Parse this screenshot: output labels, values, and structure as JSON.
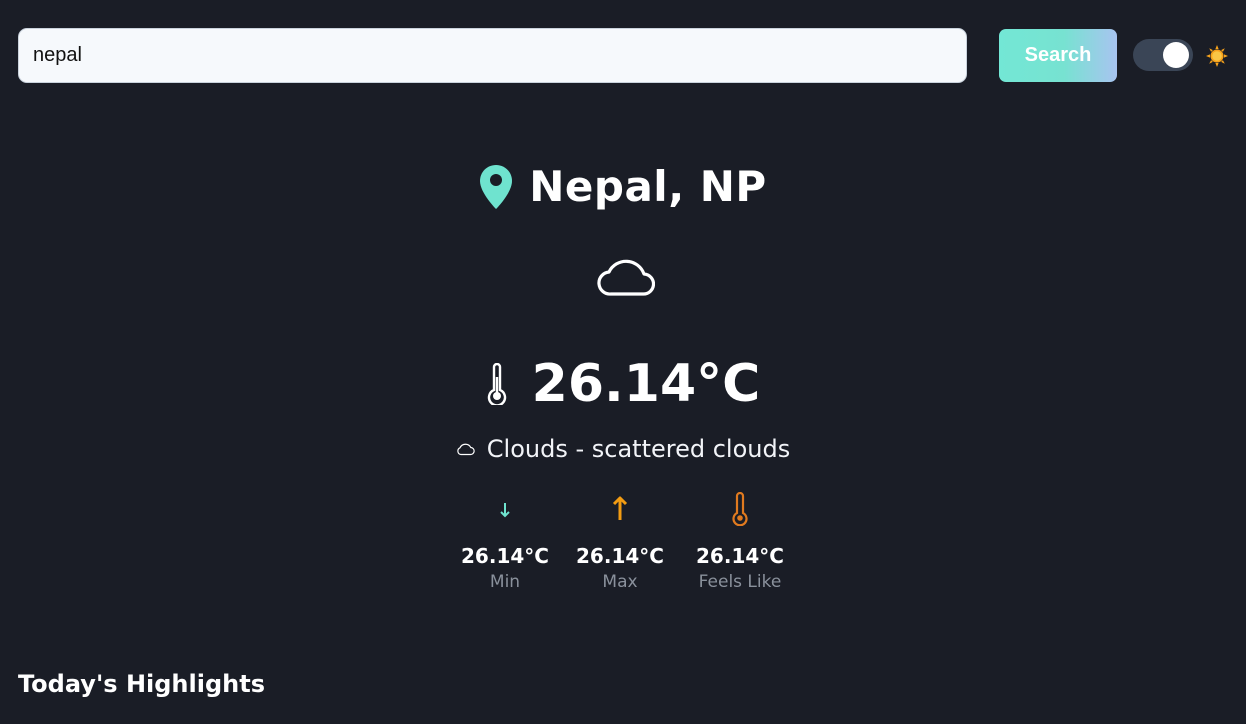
{
  "search": {
    "value": "nepal",
    "placeholder": "",
    "button_label": "Search"
  },
  "theme_toggle": {
    "state": "dark",
    "icon": "sun-icon"
  },
  "location": {
    "name": "Nepal, NP",
    "icon": "map-pin-icon"
  },
  "weather": {
    "icon": "cloud-icon",
    "temperature": "26.14°C",
    "condition": "Clouds - scattered clouds",
    "stats": [
      {
        "label": "Min",
        "value": "26.14°C",
        "icon": "arrow-down-icon"
      },
      {
        "label": "Max",
        "value": "26.14°C",
        "icon": "arrow-up-icon"
      },
      {
        "label": "Feels Like",
        "value": "26.14°C",
        "icon": "thermometer-icon"
      }
    ]
  },
  "highlights": {
    "title": "Today's Highlights"
  },
  "colors": {
    "background": "#1a1d26",
    "accent": "#6fe3cf",
    "warm": "#f39c12",
    "muted_text": "#8a919c"
  }
}
